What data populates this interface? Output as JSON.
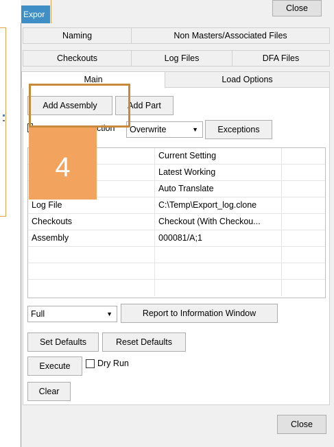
{
  "window": {
    "title": "Expor",
    "close_label": "Close"
  },
  "tabs_row1": [
    "Naming",
    "Non Masters/Associated Files"
  ],
  "tabs_row2": [
    "Checkouts",
    "Log Files",
    "DFA Files"
  ],
  "tabs_row3": [
    "Main",
    "Load Options"
  ],
  "main": {
    "add_assembly_label": "Add Assembly",
    "add_part_label": "Add Part",
    "obscured_label_fragment": "ction",
    "mode_dropdown": "Overwrite",
    "exceptions_label": "Exceptions",
    "grid": {
      "header": [
        "",
        "Current Setting",
        ""
      ],
      "rows": [
        [
          "",
          "Latest Working",
          ""
        ],
        [
          "",
          "Auto Translate",
          ""
        ],
        [
          "Log File",
          "C:\\Temp\\Export_log.clone",
          ""
        ],
        [
          "Checkouts",
          "Checkout (With Checkou...",
          ""
        ],
        [
          "Assembly",
          "000081/A;1",
          ""
        ],
        [
          "",
          "",
          ""
        ],
        [
          "",
          "",
          ""
        ],
        [
          "",
          "",
          ""
        ]
      ]
    },
    "report_dropdown": "Full",
    "report_button": "Report to Information Window",
    "set_defaults_label": "Set Defaults",
    "reset_defaults_label": "Reset Defaults",
    "execute_label": "Execute",
    "dry_run_label": "Dry Run",
    "clear_label": "Clear"
  },
  "bottom_close_label": "Close",
  "step_badge": "4",
  "colors": {
    "title_accent": "#3f8fc6",
    "highlight_border": "#c78a3a",
    "step_tile": "#f2a35e"
  }
}
